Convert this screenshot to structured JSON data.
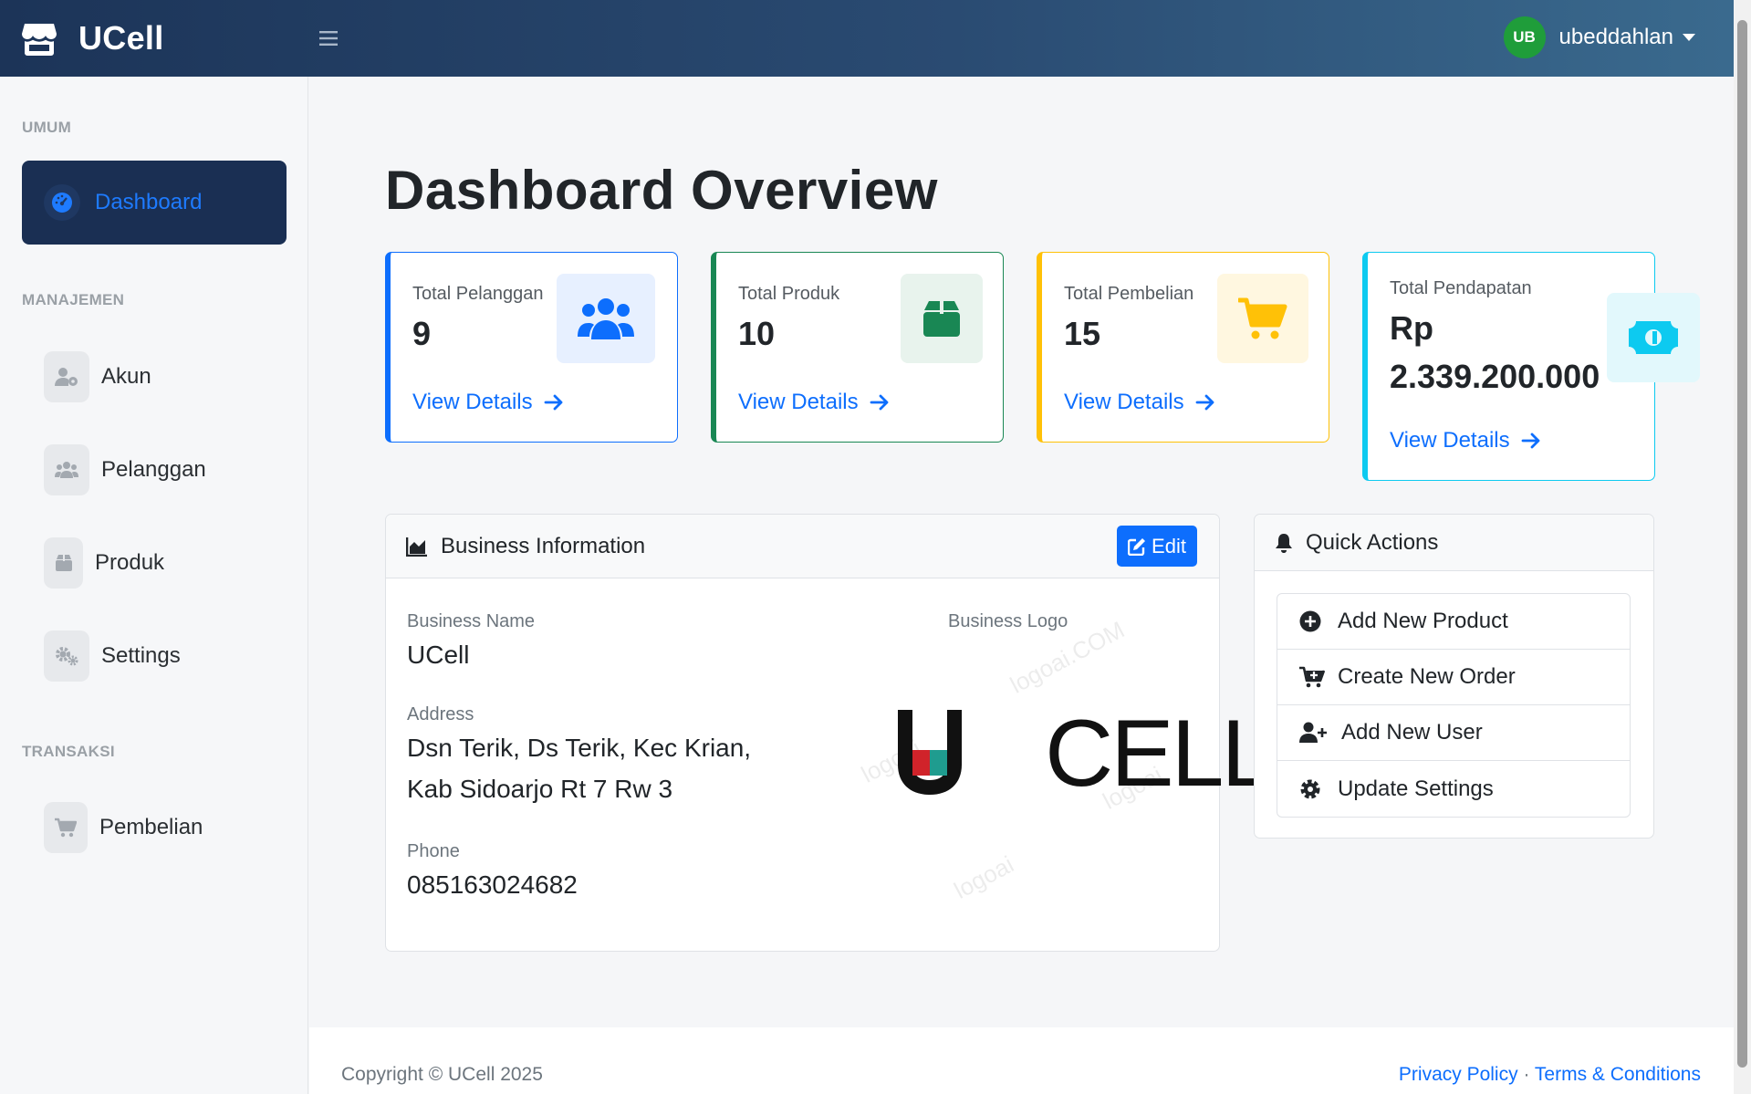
{
  "header": {
    "brand": "UCell",
    "user_initials": "UB",
    "user_name": "ubeddahlan"
  },
  "sidebar": {
    "sections": [
      {
        "title": "UMUM"
      },
      {
        "title": "MANAJEMEN"
      },
      {
        "title": "TRANSAKSI"
      }
    ],
    "items": [
      {
        "label": "Dashboard",
        "icon": "tachometer-icon",
        "active": true
      },
      {
        "label": "Akun",
        "icon": "user-cog-icon"
      },
      {
        "label": "Pelanggan",
        "icon": "users-icon"
      },
      {
        "label": "Produk",
        "icon": "box-icon"
      },
      {
        "label": "Settings",
        "icon": "cogs-icon"
      },
      {
        "label": "Pembelian",
        "icon": "cart-icon"
      }
    ]
  },
  "main": {
    "title": "Dashboard Overview",
    "stats": [
      {
        "label": "Total Pelanggan",
        "value": "9",
        "link": "View Details",
        "color": "#0d6efd",
        "icon": "users-icon"
      },
      {
        "label": "Total Produk",
        "value": "10",
        "link": "View Details",
        "color": "#198754",
        "icon": "box-icon"
      },
      {
        "label": "Total Pembelian",
        "value": "15",
        "link": "View Details",
        "color": "#ffc107",
        "icon": "cart-icon"
      },
      {
        "label": "Total Pendapatan",
        "value_line1": "Rp",
        "value_line2": "2.339.200.000",
        "link": "View Details",
        "color": "#0dcaf0",
        "icon": "money-bill-icon"
      }
    ],
    "business": {
      "title": "Business Information",
      "edit_label": "Edit",
      "name_label": "Business Name",
      "name": "UCell",
      "address_label": "Address",
      "address_line1": "Dsn Terik, Ds Terik, Kec Krian,",
      "address_line2": "Kab Sidoarjo Rt 7 Rw 3",
      "phone_label": "Phone",
      "phone": "085163024682",
      "logo_label": "Business Logo",
      "logo_text": "UCELL"
    },
    "quick_actions": {
      "title": "Quick Actions",
      "items": [
        {
          "label": "Add New Product",
          "icon": "plus-circle-icon"
        },
        {
          "label": "Create New Order",
          "icon": "cart-plus-icon"
        },
        {
          "label": "Add New User",
          "icon": "user-plus-icon"
        },
        {
          "label": "Update Settings",
          "icon": "gear-icon"
        }
      ]
    }
  },
  "footer": {
    "copyright": "Copyright © UCell 2025",
    "privacy": "Privacy Policy",
    "separator": "·",
    "terms": "Terms & Conditions"
  }
}
